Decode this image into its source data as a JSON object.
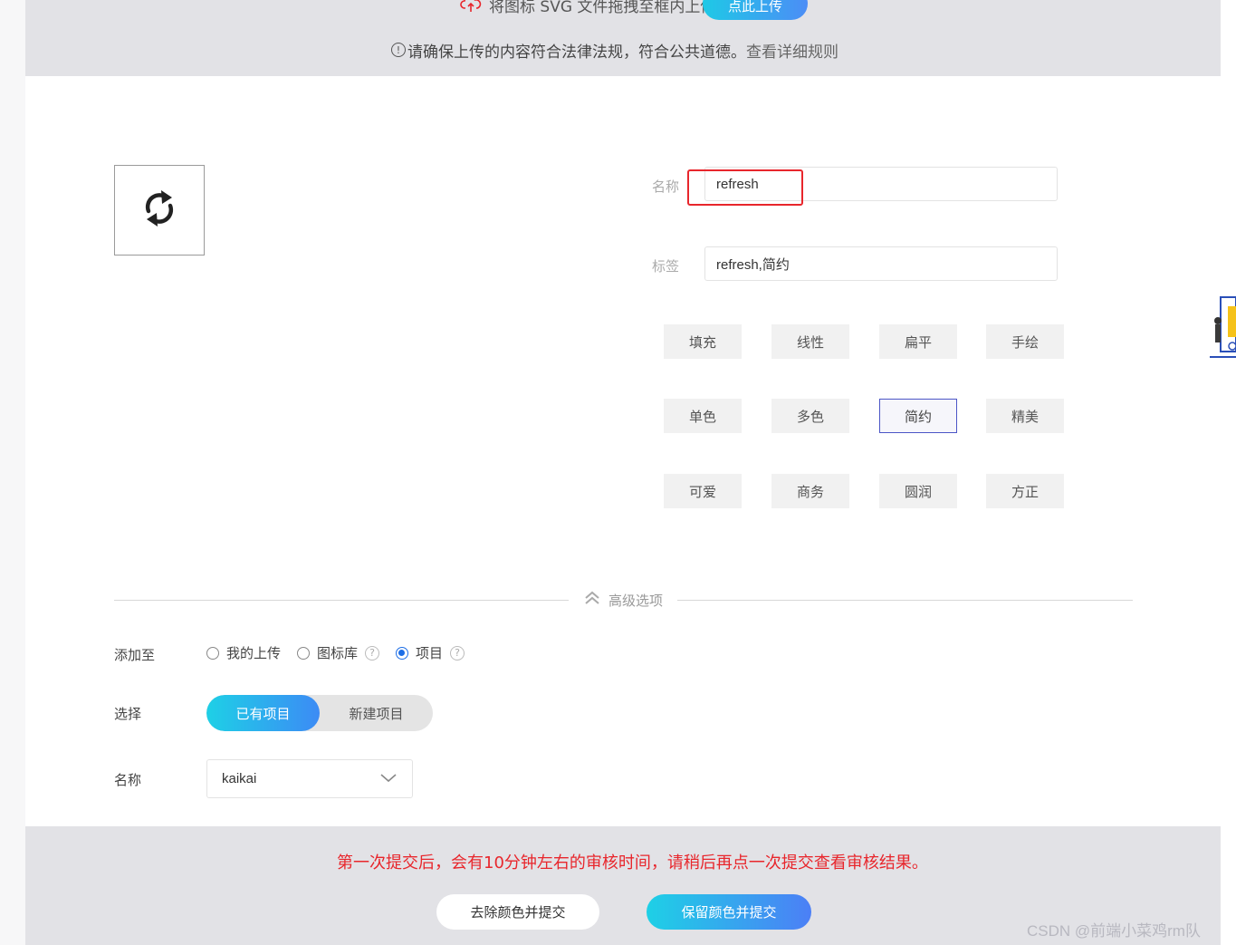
{
  "upload": {
    "drag_text": "将图标 SVG 文件拖拽至框内上传",
    "button_label": "点此上传",
    "notice_text": "请确保上传的内容符合法律法规，符合公共道德。",
    "rules_link": "查看详细规则",
    "info_glyph": "!"
  },
  "preview": {
    "icon": "refresh-icon"
  },
  "form": {
    "name_label": "名称",
    "name_value": "refresh",
    "tags_label": "标签",
    "tags_value": "refresh,简约"
  },
  "style_tags": [
    {
      "label": "填充",
      "selected": false
    },
    {
      "label": "线性",
      "selected": false
    },
    {
      "label": "扁平",
      "selected": false
    },
    {
      "label": "手绘",
      "selected": false
    },
    {
      "label": "单色",
      "selected": false
    },
    {
      "label": "多色",
      "selected": false
    },
    {
      "label": "简约",
      "selected": true
    },
    {
      "label": "精美",
      "selected": false
    },
    {
      "label": "可爱",
      "selected": false
    },
    {
      "label": "商务",
      "selected": false
    },
    {
      "label": "圆润",
      "selected": false
    },
    {
      "label": "方正",
      "selected": false
    }
  ],
  "advanced": {
    "toggle_label": "高级选项",
    "add_to_label": "添加至",
    "options": [
      {
        "label": "我的上传",
        "checked": false,
        "help": false
      },
      {
        "label": "图标库",
        "checked": false,
        "help": true
      },
      {
        "label": "项目",
        "checked": true,
        "help": true
      }
    ],
    "help_glyph": "?",
    "select_label": "选择",
    "segments": {
      "existing": "已有项目",
      "new": "新建项目",
      "active": "existing"
    },
    "name_label": "名称",
    "project_value": "kaikai"
  },
  "footer": {
    "warning": "第一次提交后，会有10分钟左右的审核时间，请稍后再点一次提交查看审核结果。",
    "remove_color_button": "去除颜色并提交",
    "keep_color_button": "保留颜色并提交",
    "watermark": "CSDN @前端小菜鸡rm队"
  },
  "colors": {
    "accent_gradient_start": "#1ed0e6",
    "accent_gradient_end": "#4c7ff6",
    "highlight_red": "#e8262c",
    "selected_tag_border": "#4b55c6",
    "band_gray": "#e2e2e6"
  }
}
